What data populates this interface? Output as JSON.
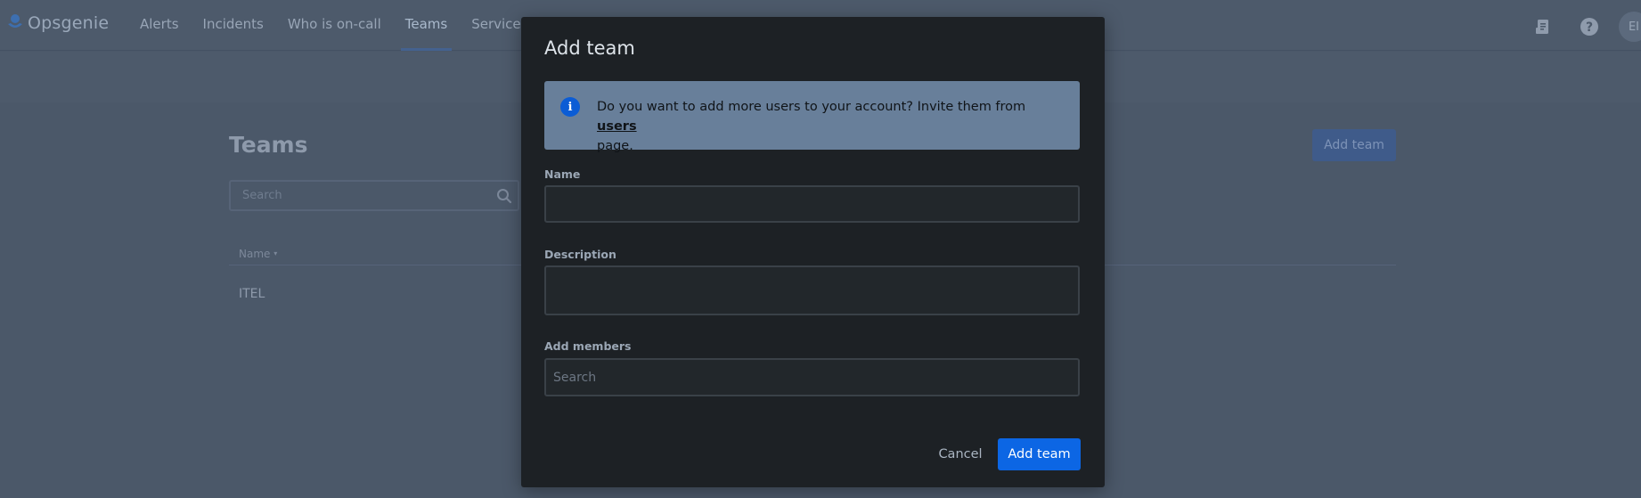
{
  "app": {
    "logo_text": "Opsgenie",
    "nav": [
      {
        "label": "Alerts"
      },
      {
        "label": "Incidents"
      },
      {
        "label": "Who is on-call"
      },
      {
        "label": "Teams"
      },
      {
        "label": "Services"
      }
    ],
    "active_nav": "Teams",
    "user_initials": "EI",
    "icons": [
      "logo-icon",
      "release-notes-icon",
      "help-icon"
    ]
  },
  "page": {
    "title": "Teams",
    "search_placeholder": "Search",
    "add_button": "Add team",
    "table": {
      "columns": [
        "Name"
      ],
      "rows": [
        [
          "ITEL"
        ]
      ]
    }
  },
  "modal": {
    "title": "Add team",
    "info": {
      "text_before": "Do you want to add more users to your account? Invite them from ",
      "link_text": "users",
      "text_after": " page."
    },
    "fields": {
      "name_label": "Name",
      "name_value": "",
      "description_label": "Description",
      "description_value": "",
      "members_label": "Add members",
      "members_placeholder": "Search"
    },
    "cancel_label": "Cancel",
    "submit_label": "Add team"
  },
  "colors": {
    "primary": "#0c66e4",
    "info_icon": "#0b5cd5",
    "modal_bg": "#1d2125",
    "overlay_bg": "#4b5869"
  }
}
